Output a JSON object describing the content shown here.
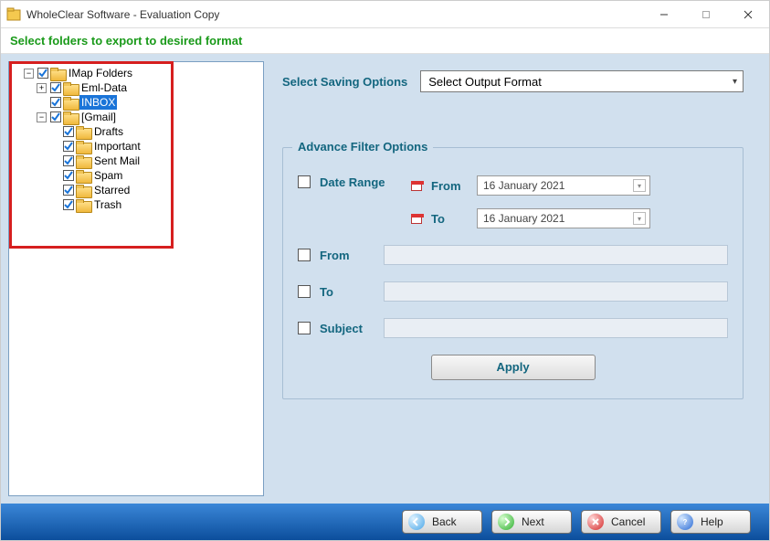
{
  "window": {
    "title": "WholeClear Software - Evaluation Copy"
  },
  "instruction": "Select folders to export to desired format",
  "tree": {
    "root_label": "IMap Folders",
    "items": [
      {
        "label": "Eml-Data",
        "toggle": "+"
      },
      {
        "label": "INBOX",
        "selected": true
      },
      {
        "label": "[Gmail]",
        "toggle": "−",
        "children": [
          {
            "label": "Drafts"
          },
          {
            "label": "Important"
          },
          {
            "label": "Sent Mail"
          },
          {
            "label": "Spam"
          },
          {
            "label": "Starred"
          },
          {
            "label": "Trash"
          }
        ]
      }
    ]
  },
  "saving": {
    "label": "Select Saving Options",
    "dropdown_text": "Select Output Format"
  },
  "filter": {
    "legend": "Advance Filter Options",
    "date_range_label": "Date Range",
    "from_sub": "From",
    "to_sub": "To",
    "from_date": "16   January    2021",
    "to_date": "16   January    2021",
    "from_label": "From",
    "to_label": "To",
    "subject_label": "Subject",
    "apply_label": "Apply"
  },
  "buttons": {
    "back": "Back",
    "next": "Next",
    "cancel": "Cancel",
    "help": "Help"
  }
}
